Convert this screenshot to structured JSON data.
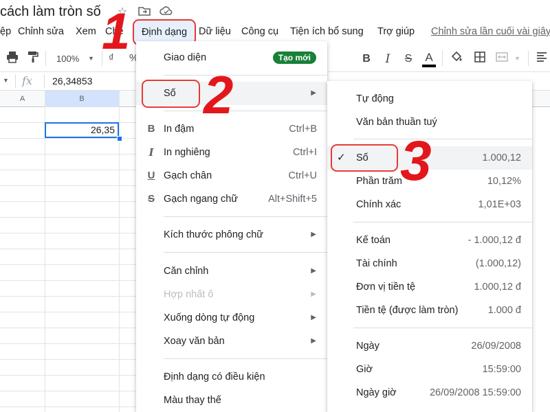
{
  "document": {
    "title": "cách làm tròn số"
  },
  "menubar": {
    "items": [
      "ệp",
      "Chỉnh sửa",
      "Xem",
      "Chè"
    ],
    "format": "Định dạng",
    "right_items": [
      "Dữ liệu",
      "Công cụ",
      "Tiện ích bổ sung",
      "Trợ giúp"
    ],
    "last_edit": "Chỉnh sửa lần cuối vài giây"
  },
  "toolbar": {
    "zoom": "100%",
    "currency": "₫",
    "percent": "%",
    "bold": "B",
    "italic": "I",
    "strike": "S",
    "text_color_letter": "A"
  },
  "formula_bar": {
    "fx": "fx",
    "value": "26,34853"
  },
  "grid": {
    "columns": [
      "A",
      "B"
    ],
    "cell_value": "26,35"
  },
  "format_menu": {
    "theme": "Giao diện",
    "theme_badge": "Tạo mới",
    "number": "Số",
    "bold": {
      "label": "In đậm",
      "shortcut": "Ctrl+B",
      "icon": "B"
    },
    "italic": {
      "label": "In nghiêng",
      "shortcut": "Ctrl+I",
      "icon": "I"
    },
    "underline": {
      "label": "Gạch chân",
      "shortcut": "Ctrl+U",
      "icon": "U"
    },
    "strikethrough": {
      "label": "Gạch ngang chữ",
      "shortcut": "Alt+Shift+5",
      "icon": "S"
    },
    "font_size": "Kích thước phông chữ",
    "align": "Căn chỉnh",
    "merge": "Hợp nhất ô",
    "wrap": "Xuống dòng tự động",
    "rotate": "Xoay văn bản",
    "conditional": "Định dạng có điều kiện",
    "alternating": "Màu thay thế"
  },
  "number_menu": {
    "items": [
      {
        "label": "Tự động",
        "value": ""
      },
      {
        "label": "Văn bản thuần tuý",
        "value": ""
      },
      {
        "label": "Số",
        "value": "1.000,12",
        "checked": true
      },
      {
        "label": "Phần trăm",
        "value": "10,12%"
      },
      {
        "label": "Chính xác",
        "value": "1,01E+03"
      },
      {
        "label": "Kế toán",
        "value": "- 1.000,12 đ"
      },
      {
        "label": "Tài chính",
        "value": "(1.000,12)"
      },
      {
        "label": "Đơn vị tiền tệ",
        "value": "1.000,12 đ"
      },
      {
        "label": "Tiền tệ (được làm tròn)",
        "value": "1.000 đ"
      },
      {
        "label": "Ngày",
        "value": "26/09/2008"
      },
      {
        "label": "Giờ",
        "value": "15:59:00"
      },
      {
        "label": "Ngày giờ",
        "value": "26/09/2008 15:59:00"
      }
    ]
  },
  "annotations": {
    "step1": "1",
    "step2": "2",
    "step3": "3"
  },
  "colors": {
    "accent": "#1a73e8",
    "highlight": "#e53935",
    "badge": "#188038"
  }
}
